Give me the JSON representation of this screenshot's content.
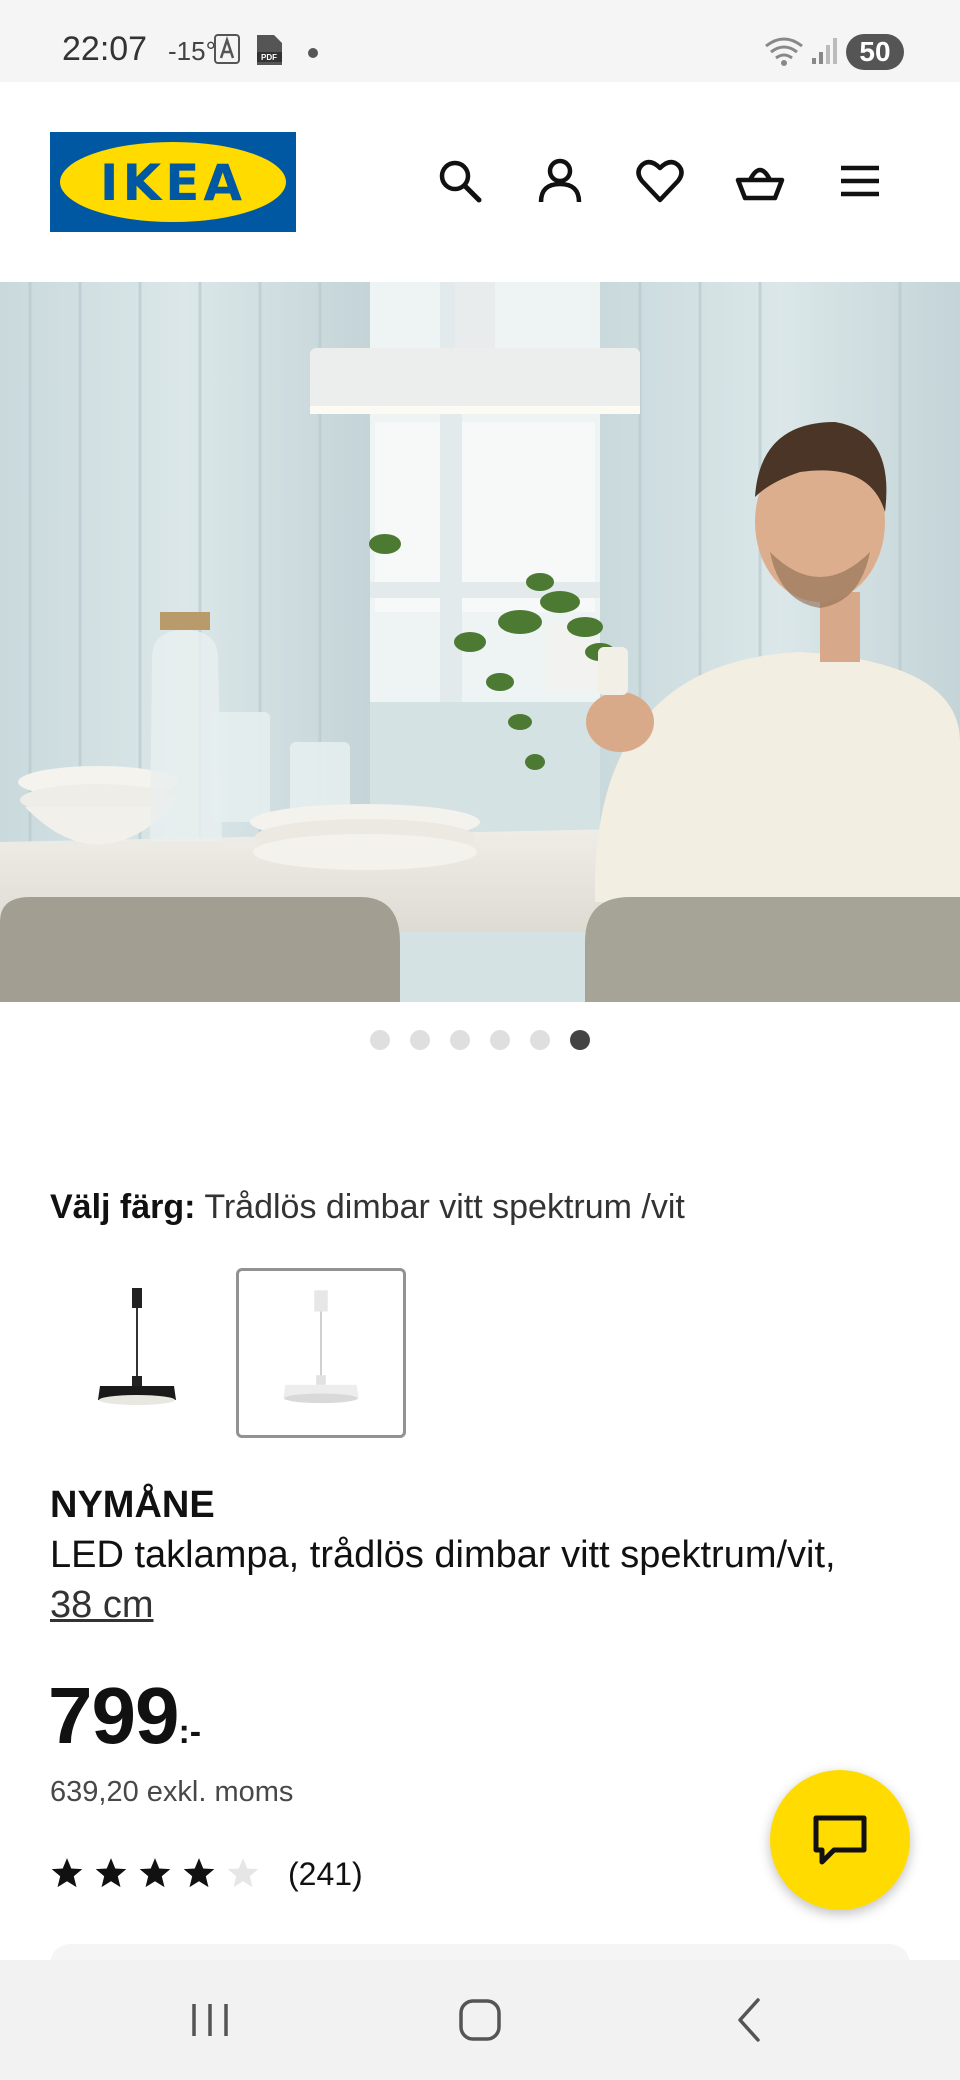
{
  "status_bar": {
    "time": "22:07",
    "temperature": "-15°",
    "battery": "50"
  },
  "header": {
    "logo_text": "IKEA",
    "icons": [
      "search-icon",
      "account-icon",
      "heart-icon",
      "basket-icon",
      "menu-icon"
    ]
  },
  "gallery": {
    "total_images": 6,
    "active_index": 5
  },
  "color_selector": {
    "label": "Välj färg:",
    "value": "Trådlös dimbar vitt spektrum /vit",
    "options": [
      "black-lamp",
      "white-lamp"
    ],
    "selected_index": 1
  },
  "product": {
    "name": "NYMÅNE",
    "description": "LED taklampa, trådlös dimbar vitt spektrum/vit,",
    "size": "38 cm",
    "price_integer": "799",
    "price_suffix": ":-",
    "price_excl": "639,20 exkl. moms",
    "rating": 4,
    "rating_max": 5,
    "review_count": "(241)"
  },
  "colors": {
    "ikea_blue": "#0058a3",
    "ikea_yellow": "#ffdb00"
  },
  "nav_bar": {
    "buttons": [
      "recents-icon",
      "home-icon",
      "back-icon"
    ]
  }
}
